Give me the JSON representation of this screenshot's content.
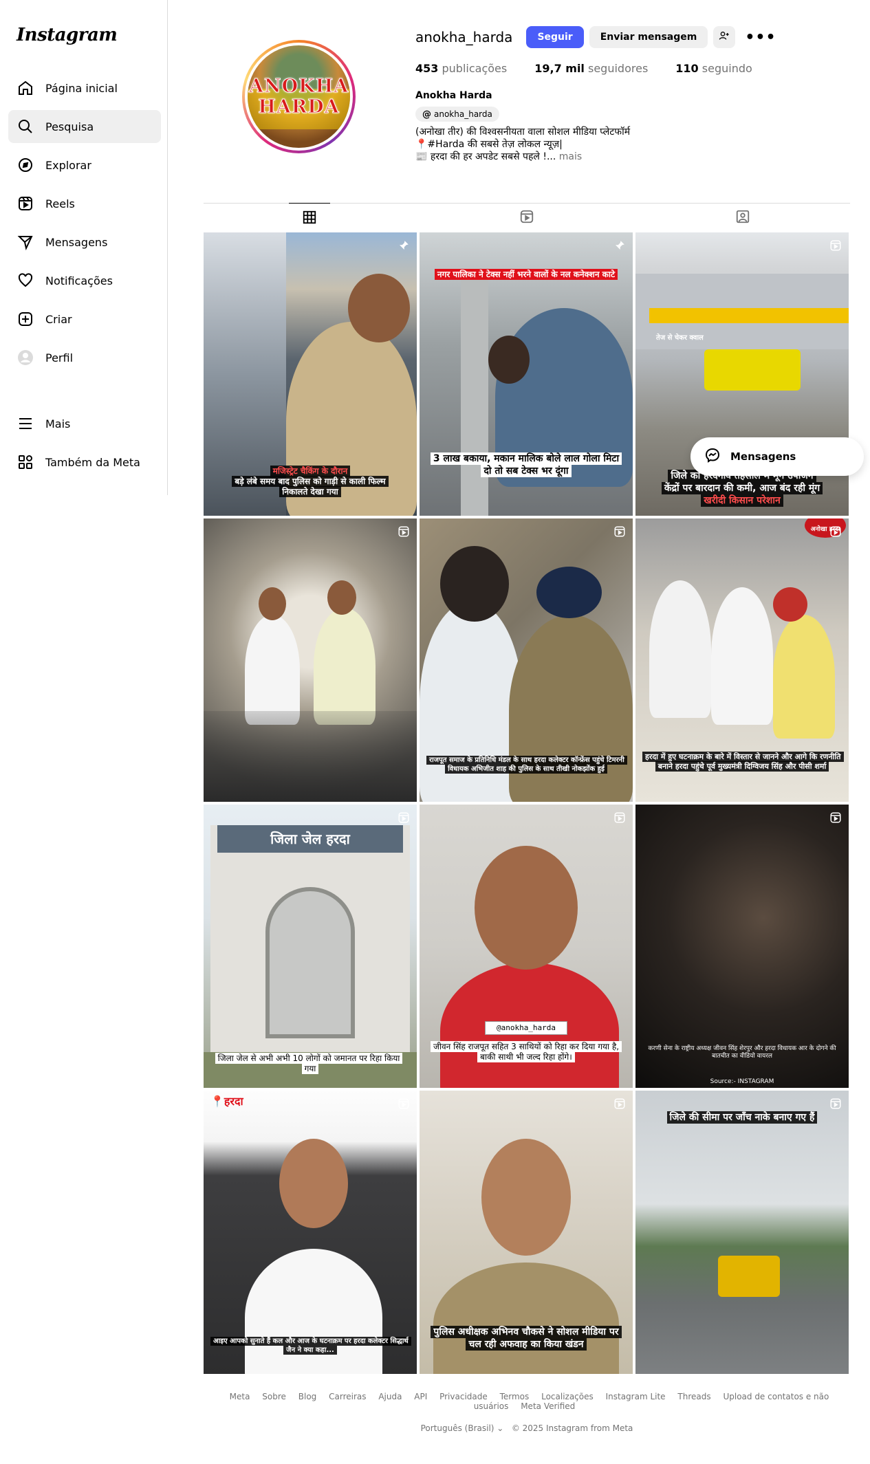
{
  "app": {
    "logo": "Instagram"
  },
  "sidebar": {
    "items": [
      {
        "label": "Página inicial",
        "icon": "home-icon"
      },
      {
        "label": "Pesquisa",
        "icon": "search-icon"
      },
      {
        "label": "Explorar",
        "icon": "compass-icon"
      },
      {
        "label": "Reels",
        "icon": "reels-icon"
      },
      {
        "label": "Mensagens",
        "icon": "messenger-icon"
      },
      {
        "label": "Notificações",
        "icon": "heart-icon"
      },
      {
        "label": "Criar",
        "icon": "plus-square-icon"
      },
      {
        "label": "Perfil",
        "icon": "avatar-icon"
      }
    ],
    "bottom": [
      {
        "label": "Mais",
        "icon": "hamburger-icon"
      },
      {
        "label": "Também da Meta",
        "icon": "meta-apps-icon"
      }
    ]
  },
  "profile": {
    "username": "anokha_harda",
    "follow_label": "Seguir",
    "message_label": "Enviar mensagem",
    "stats": {
      "posts_num": "453",
      "posts_label": "publicações",
      "followers_num": "19,7 mil",
      "followers_label": "seguidores",
      "following_num": "110",
      "following_label": "seguindo"
    },
    "full_name": "Anokha Harda",
    "threads_handle": "anokha_harda",
    "bio_line1": "(अनोखा तीर) की विश्वसनीयता वाला सोशल मीडिया प्लेटफॉर्म",
    "bio_line2": "📍#Harda की सबसे तेज़ लोकल न्यूज़|",
    "bio_line3": "📰 हरदा की हर अपडेट सबसे पहले !...",
    "bio_more": "mais",
    "avatar_text_1": "ANOKHA",
    "avatar_text_2": "HARDA"
  },
  "posts": [
    {
      "caption_1": "मजिस्ट्रेट चैकिंग के दौरान",
      "caption_2": "बड़े लंबे समय बाद पुलिस को गाड़ी से काली फिल्म",
      "caption_3": "निकालते देखा गया"
    },
    {
      "top_caption": "नगर पालिका ने टेक्स नहीं भरने वालों के नल कनेक्शन काटे",
      "caption": "3 लाख बकाया, मकान मालिक बोले लाल गोला मिटा दो तो सब टेक्स भर दूंगा"
    },
    {
      "sign": "तेज से चेकर क्वाल",
      "caption_1": "जिले का हरदगांव तहसील में मूंग उपार्जन",
      "caption_2": "केंद्रों पर बारदान की कमी, आज बंद रही मूंग",
      "caption_3": "खरीदी किसान परेशान"
    },
    {
      "caption": ""
    },
    {
      "caption": "राजपूत समाज के प्रतिनिधि मंडल के साथ हरदा कलेक्टर कॉन्फ्रेंस पहुंचे टिमरनी विधायक अभिजीत शाह की पुलिस के साथ तीखी नोकझोंक हुई"
    },
    {
      "logo": "अनोखा हरदा",
      "caption": "हरदा में हुए घटनाक्रम के बारे में विस्तार से जानने और आगे कि रणनीति बनाने हरदा पहुंचे पूर्व मुख्यमंत्री दिग्विजय सिंह और पीसी शर्मा"
    },
    {
      "sign": "जिला जेल हरदा",
      "caption": "जिला जेल से अभी अभी 10 लोगों को जमानत पर रिहा किया गया"
    },
    {
      "handle": "@anokha_harda",
      "caption": "जीवन सिंह राजपूत सहित 3 साथियों को रिहा कर दिया गया है, बाकी साथी भी जल्द रिहा होंगे।"
    },
    {
      "caption": "करणी सेना के राष्ट्रीय अध्यक्ष जीवन सिंह शेरपुर और हरदा विधायक आर के दोगने की बातचीत का वीडियो वायरल",
      "source": "Source:- INSTAGRAM"
    },
    {
      "tag": "हरदा",
      "caption": "आइए आपको सुनाते हैं कल और आज के घटनाक्रम पर हरदा कलेक्टर सिद्धार्थ जैन ने क्या कहा..."
    },
    {
      "caption": "पुलिस अधीक्षक अभिनव चौकसे ने सोशल मीडिया पर चल रही अफवाह का किया खंडन"
    },
    {
      "caption": "जिले की सीमा पर जाँच नाके बनाए गए हैं"
    }
  ],
  "messages_bubble": {
    "label": "Mensagens"
  },
  "footer": {
    "links": [
      "Meta",
      "Sobre",
      "Blog",
      "Carreiras",
      "Ajuda",
      "API",
      "Privacidade",
      "Termos",
      "Localizações",
      "Instagram Lite",
      "Threads",
      "Upload de contatos e não usuários",
      "Meta Verified"
    ],
    "language": "Português (Brasil)",
    "copyright": "© 2025 Instagram from Meta"
  }
}
